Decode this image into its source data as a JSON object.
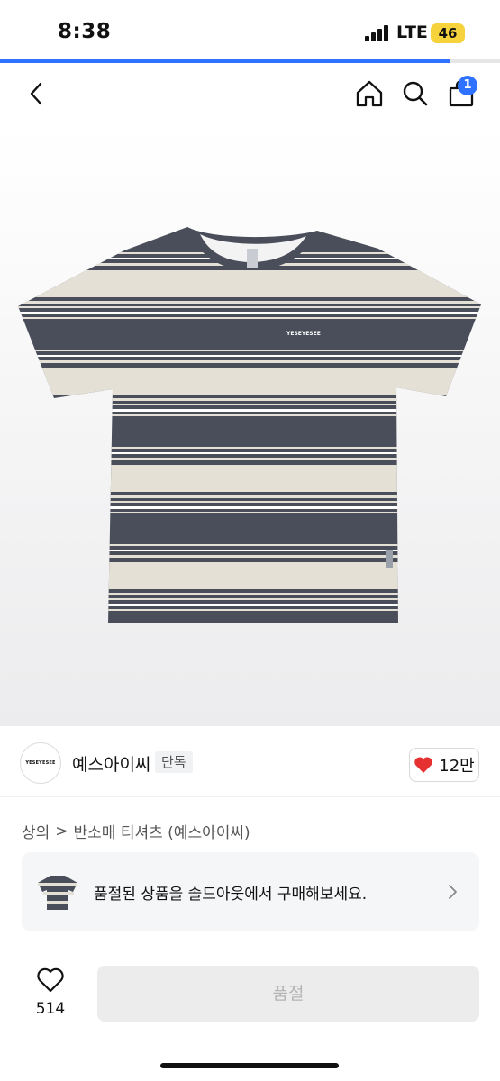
{
  "status_bar": {
    "time": "8:38",
    "network": "LTE",
    "battery": "46"
  },
  "page_progress": 0.9,
  "nav": {
    "cart_count": "1"
  },
  "product_image": {
    "brand_print": "YESEYESEE"
  },
  "shop": {
    "logo_text": "YESEYESEE",
    "name": "예스아이씨",
    "tag": "단독",
    "likes": "12만"
  },
  "breadcrumb": {
    "category": "상의",
    "separator": ">",
    "subcategory": "반소매 티셔츠 (예스아이씨)"
  },
  "promo": {
    "text": "품절된 상품을 솔드아웃에서 구매해보세요."
  },
  "bottom_bar": {
    "wish_count": "514",
    "button_label": "품절"
  },
  "colors": {
    "accent": "#2f72ff",
    "heart": "#e5312f",
    "stripe_dark": "#4a4e5a",
    "stripe_light": "#e4e0d6"
  }
}
